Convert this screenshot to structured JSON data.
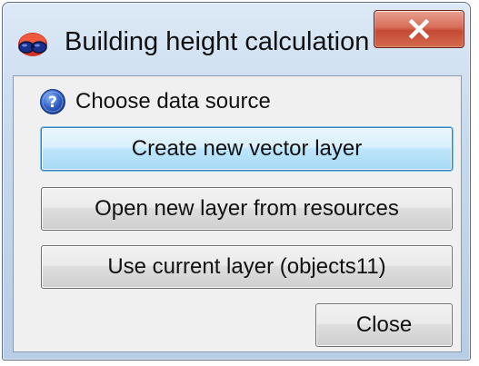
{
  "window": {
    "title": "Building height calculation",
    "app_icon": "glasses-icon",
    "close_icon": "close-icon"
  },
  "dialog": {
    "prompt_icon": "help-icon",
    "prompt": "Choose data source",
    "buttons": {
      "create": "Create new vector layer",
      "open": "Open new layer from resources",
      "current": "Use current layer (objects11)",
      "close": "Close"
    }
  },
  "colors": {
    "titlebar": "#c6d9ee",
    "close_button": "#d76d58",
    "default_button": "#bee6fd",
    "client_background": "#f0f0f0"
  }
}
